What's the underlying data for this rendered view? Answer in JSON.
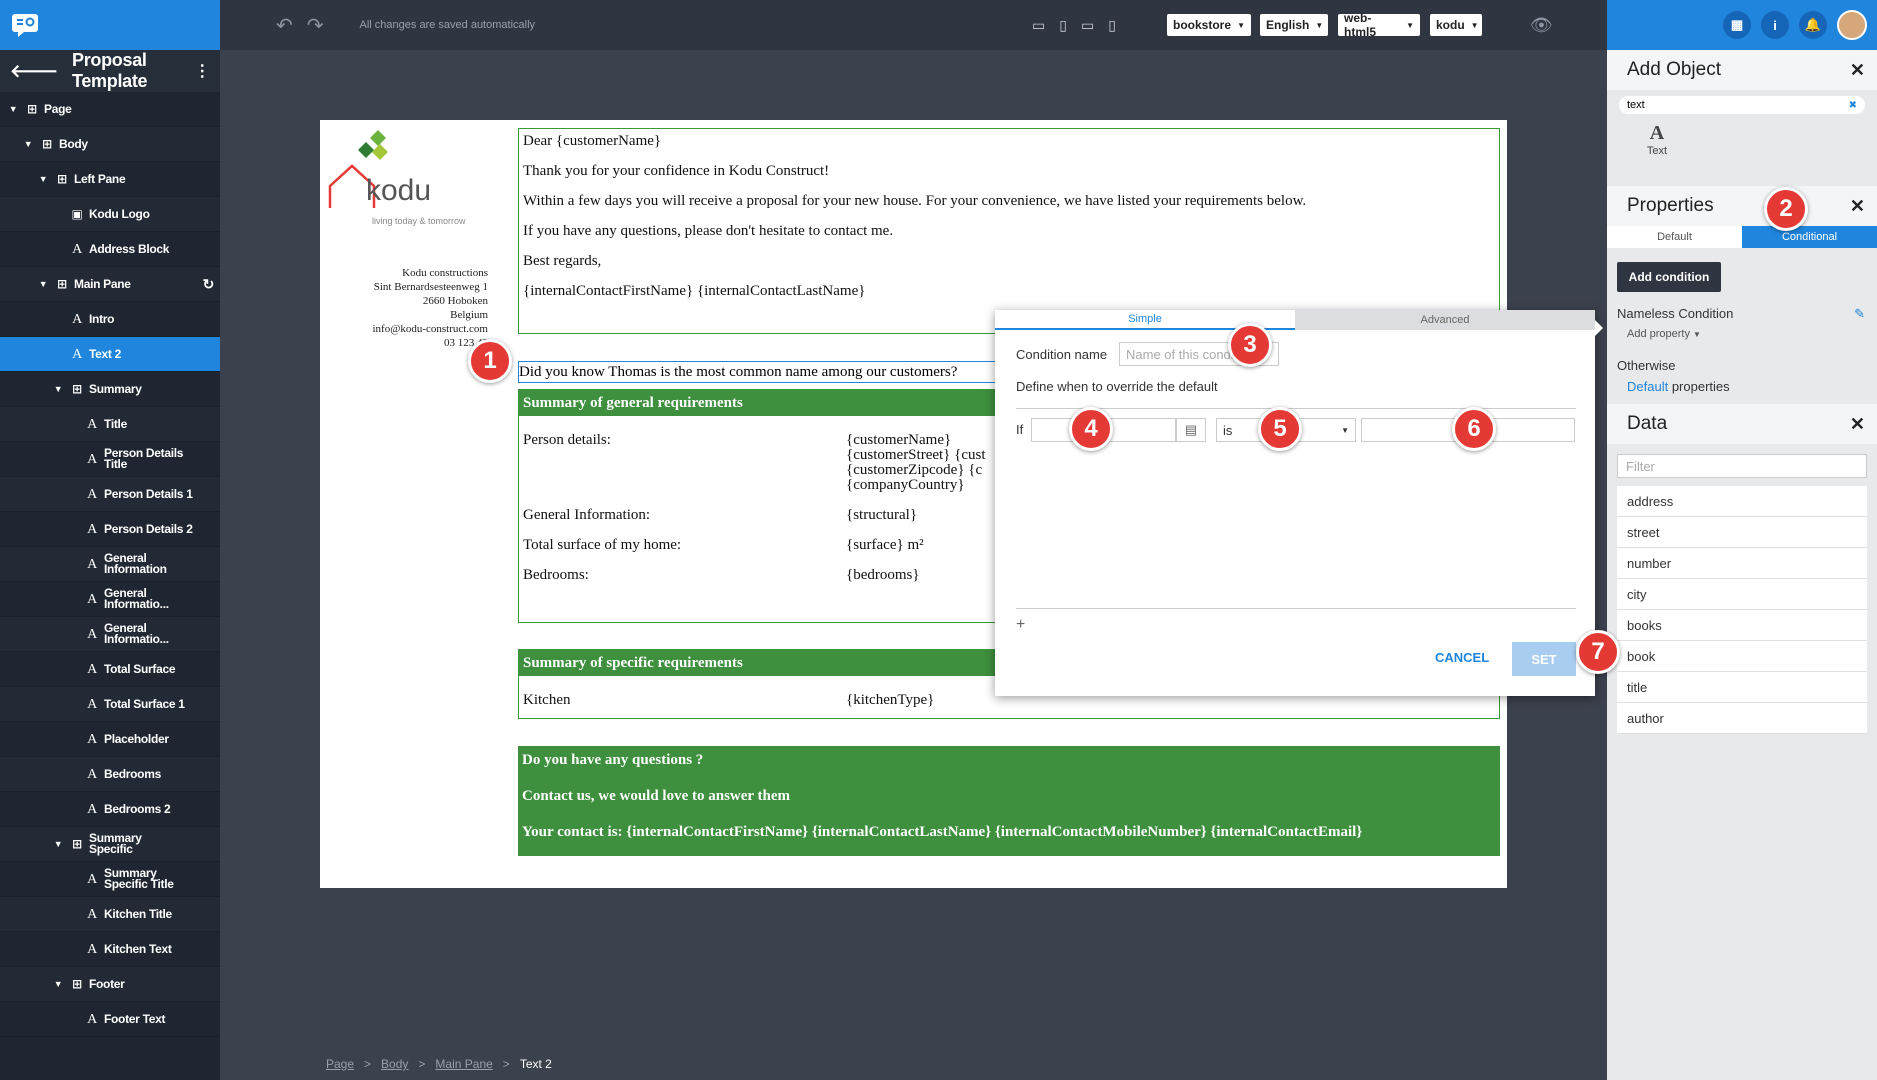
{
  "app": {
    "title": "Proposal Template"
  },
  "toolbar": {
    "saved_status": "All changes are saved automatically",
    "dropdowns": [
      "bookstore",
      "English",
      "web-html5",
      "kodu"
    ]
  },
  "tree": [
    {
      "label": "Page",
      "icon": "frame",
      "depth": 0,
      "caret": true
    },
    {
      "label": "Body",
      "icon": "frame",
      "depth": 1,
      "caret": true
    },
    {
      "label": "Left Pane",
      "icon": "frame",
      "depth": 2,
      "caret": true
    },
    {
      "label": "Kodu Logo",
      "icon": "image",
      "depth": 3,
      "caret": false
    },
    {
      "label": "Address Block",
      "icon": "text",
      "depth": 3,
      "caret": false
    },
    {
      "label": "Main Pane",
      "icon": "frame",
      "depth": 2,
      "caret": true,
      "refresh": true
    },
    {
      "label": "Intro",
      "icon": "text",
      "depth": 3,
      "caret": false
    },
    {
      "label": "Text 2",
      "icon": "text",
      "depth": 3,
      "caret": false,
      "selected": true
    },
    {
      "label": "Summary",
      "icon": "frame",
      "depth": 3,
      "caret": true
    },
    {
      "label": "Title",
      "icon": "text",
      "depth": 4,
      "caret": false
    },
    {
      "label": "Person Details Title",
      "icon": "text",
      "depth": 4,
      "caret": false
    },
    {
      "label": "Person Details 1",
      "icon": "text",
      "depth": 4,
      "caret": false
    },
    {
      "label": "Person Details 2",
      "icon": "text",
      "depth": 4,
      "caret": false
    },
    {
      "label": "General Information",
      "icon": "text",
      "depth": 4,
      "caret": false
    },
    {
      "label": "General Informatio...",
      "icon": "text",
      "depth": 4,
      "caret": false
    },
    {
      "label": "General Informatio...",
      "icon": "text",
      "depth": 4,
      "caret": false
    },
    {
      "label": "Total Surface",
      "icon": "text",
      "depth": 4,
      "caret": false
    },
    {
      "label": "Total Surface 1",
      "icon": "text",
      "depth": 4,
      "caret": false
    },
    {
      "label": "Placeholder",
      "icon": "text",
      "depth": 4,
      "caret": false
    },
    {
      "label": "Bedrooms",
      "icon": "text",
      "depth": 4,
      "caret": false
    },
    {
      "label": "Bedrooms 2",
      "icon": "text",
      "depth": 4,
      "caret": false
    },
    {
      "label": "Summary Specific",
      "icon": "frame",
      "depth": 3,
      "caret": true
    },
    {
      "label": "Summary Specific Title",
      "icon": "text",
      "depth": 4,
      "caret": false
    },
    {
      "label": "Kitchen Title",
      "icon": "text",
      "depth": 4,
      "caret": false
    },
    {
      "label": "Kitchen Text",
      "icon": "text",
      "depth": 4,
      "caret": false
    },
    {
      "label": "Footer",
      "icon": "frame",
      "depth": 3,
      "caret": true
    },
    {
      "label": "Footer Text",
      "icon": "text",
      "depth": 4,
      "caret": false
    }
  ],
  "add_object": {
    "title": "Add Object",
    "search_value": "text",
    "item_label": "Text"
  },
  "properties": {
    "title": "Properties",
    "tab_default": "Default",
    "tab_conditional": "Conditional",
    "add_condition": "Add condition",
    "condition_name": "Nameless Condition",
    "add_property": "Add property",
    "otherwise": "Otherwise",
    "default_link": "Default",
    "default_suffix": " properties"
  },
  "data_panel": {
    "title": "Data",
    "filter_placeholder": "Filter",
    "items": [
      "address",
      "street",
      "number",
      "city",
      "books",
      "book",
      "title",
      "author"
    ]
  },
  "document": {
    "logo_word": "kodu",
    "logo_tagline": "living today & tomorrow",
    "address": [
      "Kodu constructions",
      "Sint Bernardsesteenweg 1",
      "2660 Hoboken",
      "Belgium",
      "info@kodu-construct.com",
      "03 123 45"
    ],
    "intro": [
      "Dear {customerName}",
      "Thank you for your confidence in Kodu Construct!",
      "Within a few days you will receive a proposal for your new house. For your convenience, we have listed your requirements below.",
      "If you have any questions, please don't hesitate to contact me.",
      "Best regards,",
      "{internalContactFirstName} {internalContactLastName}"
    ],
    "text2": "Did you know Thomas is the most common name among our customers?",
    "summary_title": "Summary of general requirements",
    "summary_rows": [
      {
        "label": "Person details:",
        "value": [
          "{customerName}",
          "{customerStreet} {cust",
          "{customerZipcode} {c",
          "{companyCountry}"
        ]
      },
      {
        "label": "General Information:",
        "value": [
          "{structural}"
        ]
      },
      {
        "label": "Total surface of my home:",
        "value": [
          "{surface} m²"
        ]
      },
      {
        "label": "Bedrooms:",
        "value": [
          "{bedrooms}"
        ]
      }
    ],
    "specific_title": "Summary of specific requirements",
    "kitchen_label": "Kitchen",
    "kitchen_value": "{kitchenType}",
    "footer": [
      "Do you have any questions ?",
      "Contact us, we would love to answer them",
      "Your contact is: {internalContactFirstName} {internalContactLastName} {internalContactMobileNumber} {internalContactEmail}"
    ]
  },
  "dialog": {
    "tab_simple": "Simple",
    "tab_advanced": "Advanced",
    "condition_name_label": "Condition name",
    "condition_name_placeholder": "Name of this condition",
    "define_text": "Define when to override the default",
    "if_label": "If",
    "operator": "is",
    "add": "+",
    "cancel": "CANCEL",
    "set": "SET"
  },
  "badges": [
    "1",
    "2",
    "3",
    "4",
    "5",
    "6",
    "7"
  ],
  "breadcrumb": [
    "Page",
    "Body",
    "Main Pane",
    "Text 2"
  ],
  "colors": {
    "accent": "#1f85dd",
    "green": "#3e8f3e",
    "badge": "#e53935",
    "sidebar": "#1f2631"
  }
}
